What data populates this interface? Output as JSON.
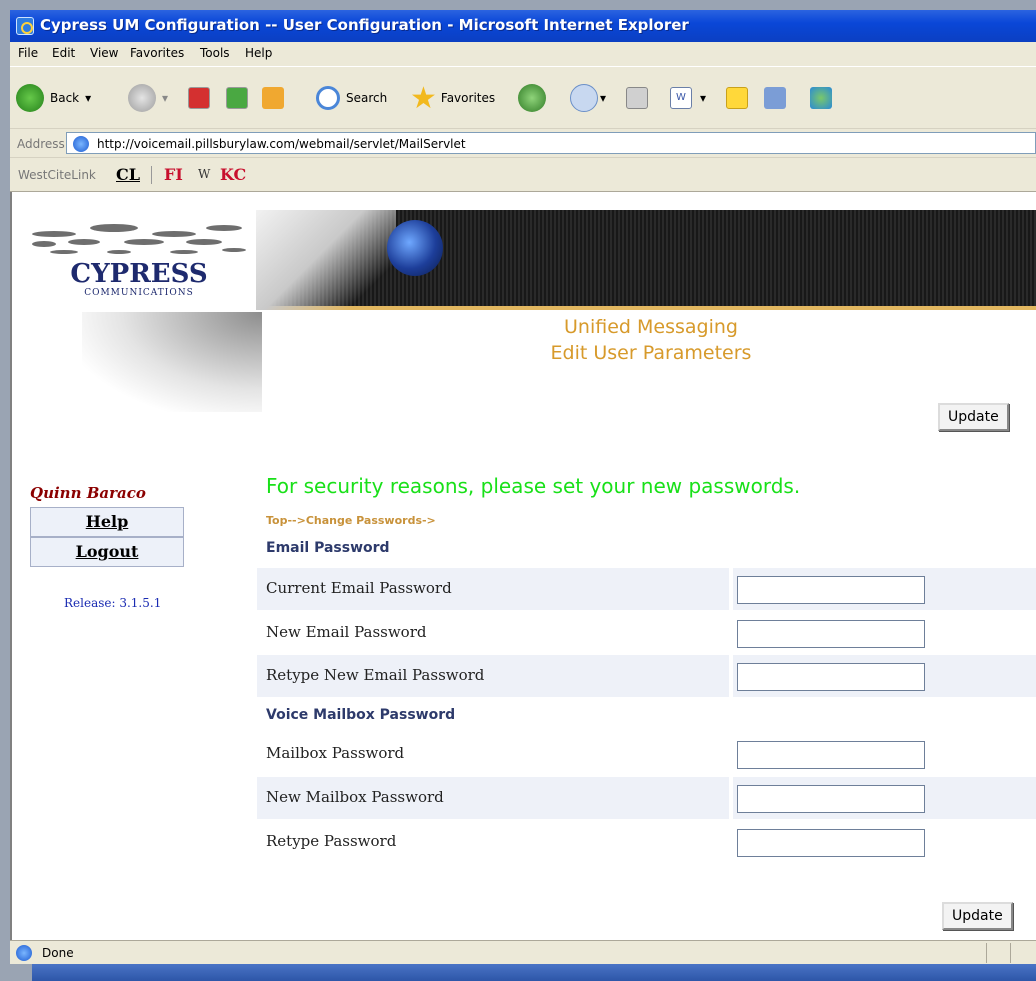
{
  "window": {
    "title": "Cypress UM Configuration -- User Configuration - Microsoft Internet Explorer"
  },
  "menu": [
    "File",
    "Edit",
    "View",
    "Favorites",
    "Tools",
    "Help"
  ],
  "toolbar": {
    "back": "Back",
    "search": "Search",
    "favorites": "Favorites"
  },
  "address": {
    "label": "Address",
    "url": "http://voicemail.pillsburylaw.com/webmail/servlet/MailServlet"
  },
  "links": {
    "westcite": "WestCiteLink",
    "cl": "CL",
    "fi": "FI",
    "w": "W",
    "kc": "KC"
  },
  "header": {
    "line1": "Unified Messaging",
    "line2": "Edit User Parameters"
  },
  "buttons": {
    "update": "Update"
  },
  "sidebar": {
    "user": "Quinn Baraco",
    "help": "Help",
    "logout": "Logout",
    "release": "Release: 3.1.5.1"
  },
  "main": {
    "notice": "For security reasons, please set your new passwords.",
    "breadcrumb": "Top-->Change Passwords->",
    "email_section": "Email Password",
    "email_rows": [
      "Current Email Password",
      "New Email Password",
      "Retype New Email Password"
    ],
    "voice_section": "Voice Mailbox Password",
    "voice_rows": [
      "Mailbox Password",
      "New Mailbox Password",
      "Retype Password"
    ]
  },
  "status": {
    "text": "Done"
  },
  "colors": {
    "titlebar": "#0a47d8",
    "heading": "#d79a2b",
    "notice": "#19e019",
    "username": "#8b0000",
    "release": "#1a2bb2",
    "row_shade": "#eef1f8"
  }
}
